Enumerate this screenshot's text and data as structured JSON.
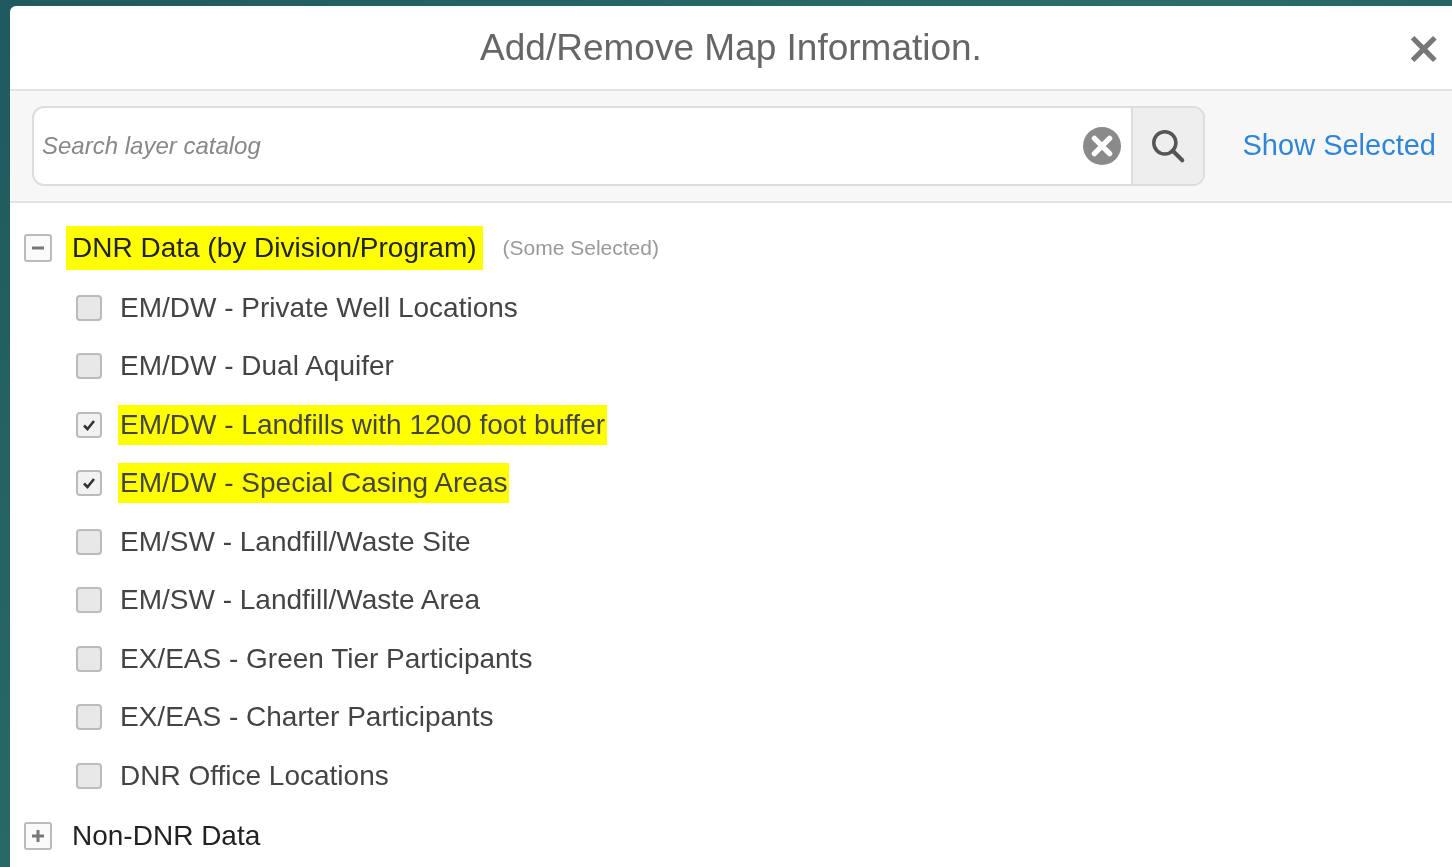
{
  "dialog": {
    "title": "Add/Remove Map Information.",
    "close": "×"
  },
  "search": {
    "placeholder": "Search layer catalog",
    "show_selected": "Show Selected"
  },
  "tree": [
    {
      "label": "DNR Data (by Division/Program)",
      "expanded": true,
      "highlighted": true,
      "status": "(Some Selected)",
      "children": [
        {
          "label": "EM/DW - Private Well Locations",
          "checked": false,
          "highlighted": false
        },
        {
          "label": "EM/DW - Dual Aquifer",
          "checked": false,
          "highlighted": false
        },
        {
          "label": "EM/DW - Landfills with 1200 foot buffer",
          "checked": true,
          "highlighted": true
        },
        {
          "label": "EM/DW - Special Casing Areas",
          "checked": true,
          "highlighted": true
        },
        {
          "label": "EM/SW - Landfill/Waste Site",
          "checked": false,
          "highlighted": false
        },
        {
          "label": "EM/SW - Landfill/Waste Area",
          "checked": false,
          "highlighted": false
        },
        {
          "label": "EX/EAS - Green Tier Participants",
          "checked": false,
          "highlighted": false
        },
        {
          "label": "EX/EAS - Charter Participants",
          "checked": false,
          "highlighted": false
        },
        {
          "label": "DNR Office Locations",
          "checked": false,
          "highlighted": false
        }
      ]
    },
    {
      "label": "Non-DNR Data",
      "expanded": false,
      "highlighted": false
    }
  ]
}
